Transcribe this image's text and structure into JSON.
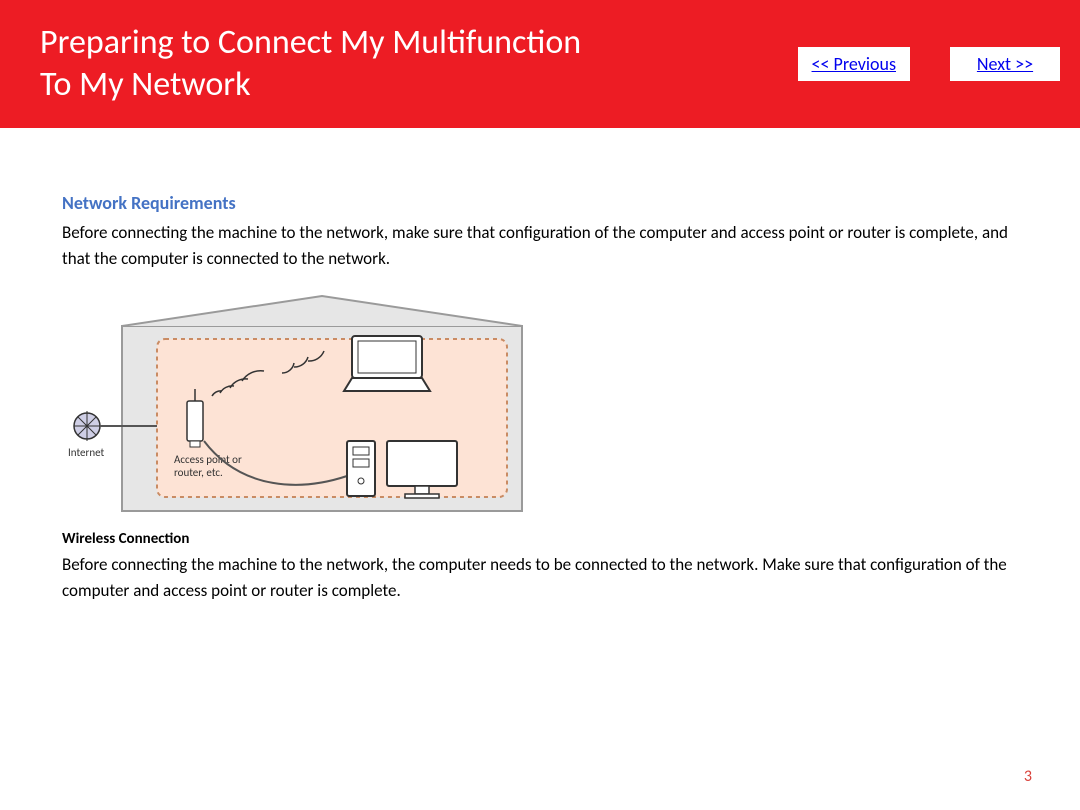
{
  "header": {
    "title_line1": "Preparing to Connect My Multifunction",
    "title_line2": "To My Network",
    "prev_label": "<< Previous",
    "next_label": "Next >>"
  },
  "content": {
    "section_heading": "Network Requirements",
    "intro_paragraph": "Before connecting the machine to the network, make sure that configuration of the computer and access point or router is complete, and that the computer is connected to the network.",
    "diagram": {
      "internet_label": "Internet",
      "router_label_line1": "Access point or",
      "router_label_line2": "router, etc."
    },
    "sub_heading": "Wireless Connection",
    "wireless_paragraph": "Before connecting the machine to the network, the computer needs to be connected to the network. Make sure that configuration of the computer and access point or router is complete."
  },
  "footer": {
    "page_number": "3"
  }
}
